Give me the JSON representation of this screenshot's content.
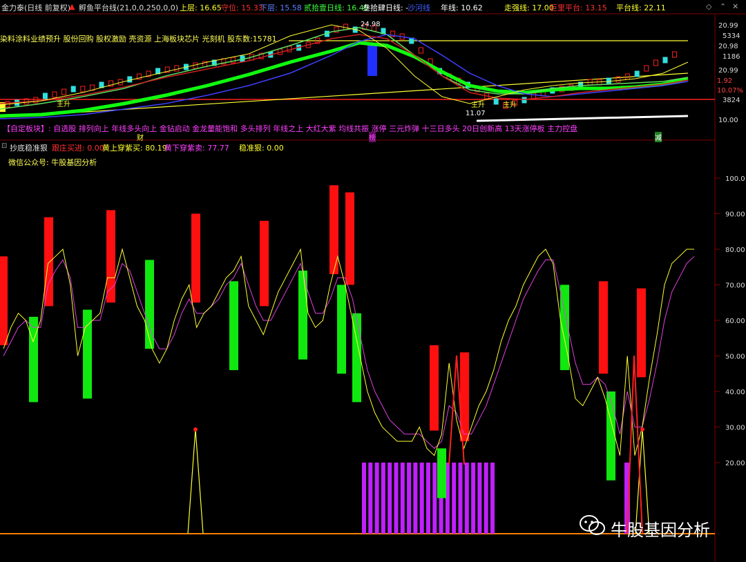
{
  "topbar": {
    "stock": "金力泰(日线 前复权)",
    "indicator": "孵鱼平台线(21,0,0,250,0,0)",
    "upper": "上层: 16.65",
    "guard": "守位: 15.33",
    "lower": "下层: 15.58",
    "daily2": "贰拾壹日线: 16.49",
    "daily3": "叁拾肆日线: -",
    "sp": "沙河线",
    "year": "年线: 10.62",
    "strong": "走强线: 17.00",
    "giant": "巨里平台: 13.15",
    "platform": "平台线: 22.11"
  },
  "tagline": "染料涂料业绩预升  股份回购  股权激励  壳资源  上海板块芯片  光刻机  股东数:15781",
  "signals": "【自定板块】: 自选股 排列向上 年线多头向上 金钻启动 金龙量能饱和 多头排列 年线之上 大红大紫 均线共振 涨停 三元炸弹 十三日多头 20日创新高 13天涨停板 主力控盘",
  "price_annotations": {
    "high": "24.98",
    "low": "11.07",
    "zs1": "主升",
    "zs2": "主升",
    "zs3": "主升"
  },
  "top_markers": {
    "cai": "财",
    "bang": "榜",
    "jian": "减"
  },
  "top_axis": [
    "20.99",
    "5334",
    "20.98",
    "1186",
    "20.99",
    "1.92",
    "10.07%",
    "3824",
    "10.00"
  ],
  "panel2": {
    "title": "抄底稳准狠",
    "t1": "跟庄买进: 0.00",
    "t2": "黄上穿紫买: 80.19",
    "t3": "黄下穿紫卖: 77.77",
    "t4": "稳准狠: 0.00"
  },
  "wechat": "微信公众号: 牛股基因分析",
  "watermark": "牛股基因分析",
  "colors": {
    "up": "#ff1010",
    "down": "#10e810",
    "yellow": "#ffff30",
    "magenta": "#e040e0",
    "purple": "#c020ff",
    "orange": "#ff8000"
  },
  "chart_data": {
    "type": "bar",
    "title": "抄底稳准狠",
    "ylim": [
      10,
      105
    ],
    "yticks": [
      20,
      30,
      40,
      50,
      60,
      70,
      80,
      90,
      100
    ],
    "ytick_labels": [
      "20.00",
      "30.00",
      "40.00",
      "50.00",
      "60.00",
      "70.00",
      "80.00",
      "90.00",
      "100.0"
    ],
    "series": [
      {
        "name": "黄线",
        "values": [
          52,
          58,
          62,
          60,
          54,
          60,
          76,
          78,
          80,
          70,
          50,
          58,
          60,
          62,
          72,
          72,
          80,
          72,
          64,
          60,
          52,
          48,
          52,
          60,
          66,
          70,
          58,
          62,
          64,
          68,
          72,
          74,
          78,
          64,
          60,
          56,
          62,
          68,
          72,
          76,
          80,
          62,
          58,
          60,
          70,
          78,
          70,
          60,
          50,
          40,
          34,
          30,
          28,
          26,
          26,
          26,
          30,
          24,
          22,
          28,
          48,
          32,
          24,
          30,
          36,
          40,
          46,
          54,
          60,
          64,
          70,
          74,
          78,
          80,
          76,
          60,
          50,
          38,
          36,
          40,
          44,
          38,
          30,
          22,
          50,
          22,
          30,
          44,
          56,
          70,
          76,
          78,
          80,
          80
        ]
      },
      {
        "name": "紫线",
        "values": [
          50,
          54,
          58,
          60,
          58,
          58,
          70,
          74,
          77,
          72,
          58,
          58,
          60,
          60,
          68,
          70,
          76,
          74,
          68,
          62,
          56,
          52,
          52,
          56,
          62,
          66,
          62,
          62,
          64,
          66,
          70,
          72,
          76,
          70,
          64,
          60,
          60,
          64,
          68,
          72,
          76,
          68,
          62,
          62,
          66,
          72,
          72,
          66,
          56,
          46,
          40,
          36,
          32,
          30,
          28,
          28,
          28,
          26,
          24,
          26,
          36,
          34,
          28,
          28,
          32,
          36,
          42,
          48,
          54,
          60,
          66,
          70,
          74,
          77,
          77,
          68,
          58,
          48,
          42,
          42,
          44,
          42,
          36,
          28,
          40,
          30,
          30,
          38,
          48,
          60,
          68,
          72,
          76,
          78
        ]
      },
      {
        "name": "红柱",
        "values": [
          [
            78,
            53
          ],
          [
            89,
            64
          ],
          [
            91,
            65
          ],
          [
            90,
            65
          ],
          [
            88,
            64
          ],
          [
            98,
            73
          ],
          [
            96,
            70
          ],
          [
            53,
            29
          ],
          [
            51,
            26
          ],
          [
            71,
            45
          ],
          [
            69,
            44
          ]
        ]
      },
      {
        "name": "绿柱",
        "values": [
          [
            61,
            37
          ],
          [
            63,
            38
          ],
          [
            77,
            52
          ],
          [
            71,
            46
          ],
          [
            74,
            49
          ],
          [
            70,
            45
          ],
          [
            62,
            37
          ],
          [
            24,
            10
          ],
          [
            70,
            46
          ],
          [
            40,
            15
          ]
        ]
      },
      {
        "name": "紫柱",
        "values": [
          20,
          20,
          20,
          20,
          20,
          20,
          20,
          20,
          20,
          20,
          20,
          20,
          20,
          20,
          20,
          20,
          20,
          20,
          20,
          20,
          20
        ]
      }
    ]
  }
}
